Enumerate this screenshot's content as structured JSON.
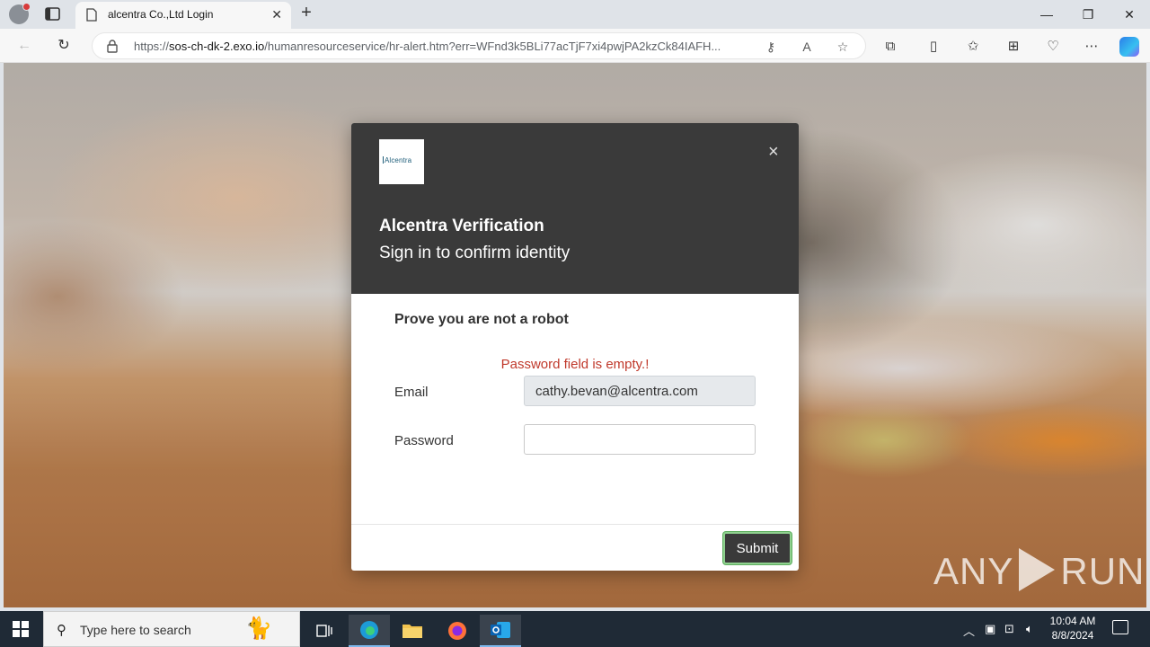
{
  "browser": {
    "tab_title": "alcentra Co.,Ltd Login",
    "url_prefix": "https://",
    "url_host": "sos-ch-dk-2.exo.io",
    "url_rest": "/humanresourceservice/hr-alert.htm?err=WFnd3k5BLi77acTjF7xi4pwjPA2kzCk84IAFH..."
  },
  "modal": {
    "logo_text": "Alcentra",
    "title": "Alcentra Verification",
    "subtitle": "Sign in to confirm identity",
    "robot_heading": "Prove you are not a robot",
    "error_message": "Password field is empty.!",
    "email_label": "Email",
    "email_value": "cathy.bevan@alcentra.com",
    "password_label": "Password",
    "password_value": "",
    "submit_label": "Submit",
    "close_glyph": "×"
  },
  "watermark": {
    "left": "ANY",
    "right": "RUN"
  },
  "taskbar": {
    "search_placeholder": "Type here to search",
    "clock_time": "10:04 AM",
    "clock_date": "8/8/2024"
  },
  "colors": {
    "modal_header": "#3a3a3a",
    "error_text": "#c0392b",
    "submit_border": "#8fd18f",
    "taskbar_bg": "#1f2a36"
  }
}
